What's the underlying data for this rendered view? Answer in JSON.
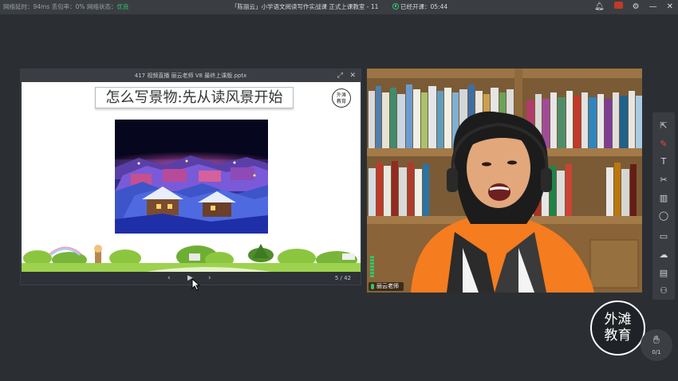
{
  "topbar": {
    "net_latency": "网络延时：94ms",
    "packet_loss": "丢包率：0%",
    "net_status_label": "网络状态：",
    "net_status_value": "优良",
    "title": "「陈丽云」小学语文阅读写作实战课 正式上课教室 - 11",
    "elapsed_label": "已经开课：",
    "elapsed_time": "05:44",
    "icons": [
      "bell-icon",
      "record-icon",
      "settings-icon",
      "minimize-icon",
      "close-icon"
    ]
  },
  "slide": {
    "filename": "417 视频直播 丽云老师 V8 最终上课版.pptx",
    "heading": "怎么写景物:先从读风景开始",
    "logo_line1": "外滩",
    "logo_line2": "教育",
    "page": "5 / 42",
    "nav_prev": "‹",
    "nav_play": "▶",
    "nav_next": "›"
  },
  "video": {
    "teacher_label": "丽云老师"
  },
  "toolbar": {
    "tools": [
      "pointer-icon",
      "pen-icon",
      "text-icon",
      "scissors-icon",
      "trash-icon",
      "shape-icon",
      "comment-icon",
      "cloud-icon",
      "toolbox-icon",
      "group-icon"
    ]
  },
  "brand": {
    "line1": "外滩",
    "line2": "教育"
  },
  "hand": {
    "count": "0/1"
  },
  "colors": {
    "status_good": "#35c26b",
    "record": "#c0392b",
    "background": "#2b2f33"
  }
}
